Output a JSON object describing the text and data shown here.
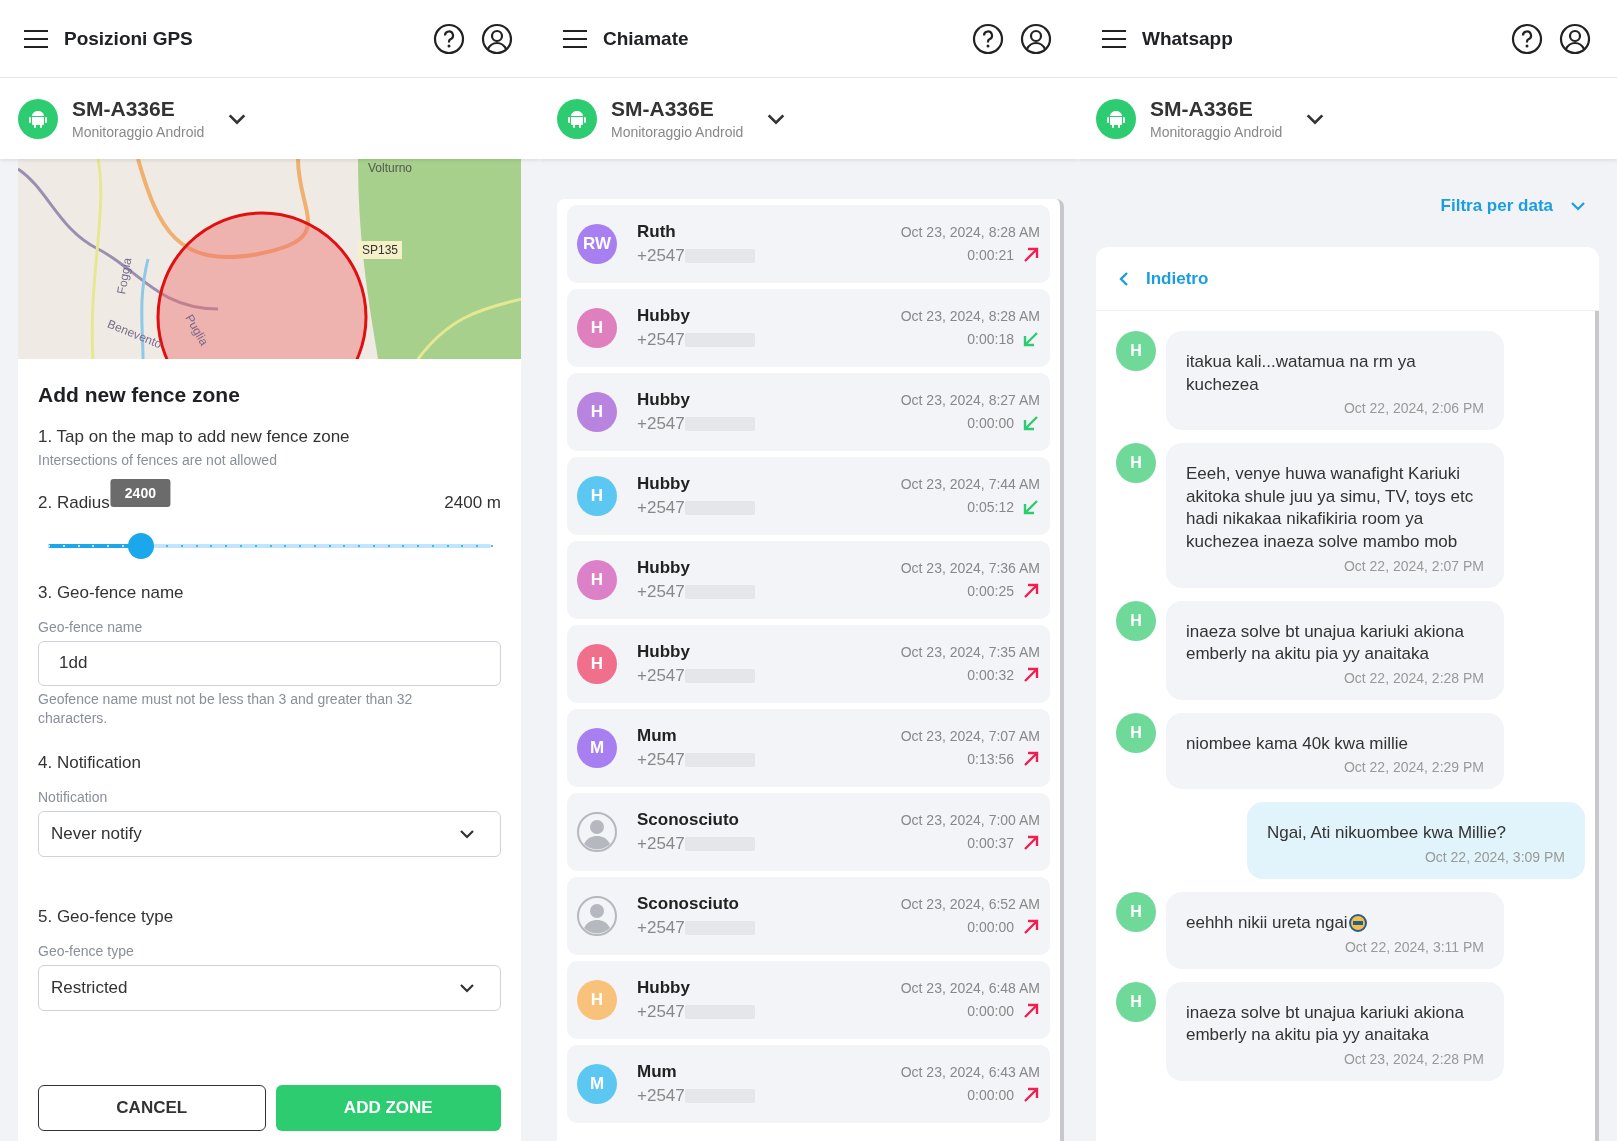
{
  "panels": [
    {
      "title": "Posizioni GPS",
      "device": {
        "name": "SM-A336E",
        "subtitle": "Monitoraggio Android"
      }
    },
    {
      "title": "Chiamate",
      "device": {
        "name": "SM-A336E",
        "subtitle": "Monitoraggio Android"
      }
    },
    {
      "title": "Whatsapp",
      "device": {
        "name": "SM-A336E",
        "subtitle": "Monitoraggio Android"
      }
    }
  ],
  "map": {
    "labels": [
      "Volturno",
      "SP135",
      "Foggia",
      "Benevento",
      "Puglia"
    ]
  },
  "fence_form": {
    "title": "Add new fence zone",
    "step_1": "1. Tap on the map to add new fence zone",
    "step_1_hint": "Intersections of fences are not allowed",
    "radius_label": "2. Radius",
    "radius_value": "2400 m",
    "radius_tooltip": "2400",
    "radius_slider": {
      "level": 0.21
    },
    "name_step": "3. Geo-fence name",
    "name_label": "Geo-fence name",
    "name_value": "1dd",
    "name_helper": "Geofence name must not be less than 3 and greater than 32 characters.",
    "notification_step": "4. Notification",
    "notification_label": "Notification",
    "notification_value": "Never notify",
    "type_step": "5. Geo-fence type",
    "type_label": "Geo-fence type",
    "type_value": "Restricted",
    "buttons": [
      {
        "label": "CANCEL",
        "kind": "secondary"
      },
      {
        "label": "ADD ZONE",
        "kind": "primary"
      }
    ]
  },
  "calls": [
    {
      "name": "Ruth",
      "initials": "RW",
      "color": "#a77ff0",
      "number": "+2547",
      "time": "Oct 23, 2024, 8:28 AM",
      "duration": "0:00:21",
      "kind": "outgoing"
    },
    {
      "name": "Hubby",
      "initials": "H",
      "color": "#e07fbd",
      "number": "+2547",
      "time": "Oct 23, 2024, 8:28 AM",
      "duration": "0:00:18",
      "kind": "incoming"
    },
    {
      "name": "Hubby",
      "initials": "H",
      "color": "#b884e0",
      "number": "+2547",
      "time": "Oct 23, 2024, 8:27 AM",
      "duration": "0:00:00",
      "kind": "incoming"
    },
    {
      "name": "Hubby",
      "initials": "H",
      "color": "#5cc8f2",
      "number": "+2547",
      "time": "Oct 23, 2024, 7:44 AM",
      "duration": "0:05:12",
      "kind": "incoming"
    },
    {
      "name": "Hubby",
      "initials": "H",
      "color": "#dc80c8",
      "number": "+2547",
      "time": "Oct 23, 2024, 7:36 AM",
      "duration": "0:00:25",
      "kind": "outgoing"
    },
    {
      "name": "Hubby",
      "initials": "H",
      "color": "#f0708c",
      "number": "+2547",
      "time": "Oct 23, 2024, 7:35 AM",
      "duration": "0:00:32",
      "kind": "outgoing"
    },
    {
      "name": "Mum",
      "initials": "M",
      "color": "#a77ff0",
      "number": "+2547",
      "time": "Oct 23, 2024, 7:07 AM",
      "duration": "0:13:56",
      "kind": "outgoing"
    },
    {
      "name": "Sconosciuto",
      "color": "#b5b8be",
      "number": "+2547",
      "time": "Oct 23, 2024, 7:00 AM",
      "duration": "0:00:37",
      "kind": "outgoing"
    },
    {
      "name": "Sconosciuto",
      "color": "#b5b8be",
      "number": "+2547",
      "time": "Oct 23, 2024, 6:52 AM",
      "duration": "0:00:00",
      "kind": "outgoing"
    },
    {
      "name": "Hubby",
      "initials": "H",
      "color": "#f8c27a",
      "number": "+2547",
      "time": "Oct 23, 2024, 6:48 AM",
      "duration": "0:00:00",
      "kind": "outgoing"
    },
    {
      "name": "Mum",
      "initials": "M",
      "color": "#5cc8f2",
      "number": "+2547",
      "time": "Oct 23, 2024, 6:43 AM",
      "duration": "0:00:00",
      "kind": "outgoing"
    }
  ],
  "whatsapp": {
    "filter": "Filtra per data",
    "back": "Indietro",
    "messages": [
      {
        "kind": "incoming",
        "initials": "H",
        "text": "itakua kali...watamua na rm ya kuchezea",
        "time": "Oct 22, 2024, 2:06 PM"
      },
      {
        "kind": "incoming",
        "initials": "H",
        "text": "Eeeh, venye huwa wanafight Kariuki akitoka shule juu ya simu, TV, toys etc hadi nikakaa nikafikiria room ya kuchezea inaeza solve mambo mob",
        "time": "Oct 22, 2024, 2:07 PM"
      },
      {
        "kind": "incoming",
        "initials": "H",
        "text": "inaeza solve bt unajua kariuki akiona emberly na akitu pia yy anaitaka",
        "time": "Oct 22, 2024, 2:28 PM"
      },
      {
        "kind": "incoming",
        "initials": "H",
        "text": "niombee kama 40k kwa millie",
        "time": "Oct 22, 2024, 2:29 PM"
      },
      {
        "kind": "outgoing",
        "text": "Ngai, Ati nikuombee kwa Millie?",
        "time": "Oct 22, 2024, 3:09 PM"
      },
      {
        "kind": "incoming",
        "initials": "H",
        "text": "eehhh nikii ureta ngai",
        "emoji": true,
        "time": "Oct 22, 2024, 3:11 PM"
      },
      {
        "kind": "incoming",
        "initials": "H",
        "text": "inaeza solve bt unajua kariuki akiona emberly na akitu pia yy anaitaka",
        "time": "Oct 23, 2024, 2:28 PM"
      }
    ]
  }
}
